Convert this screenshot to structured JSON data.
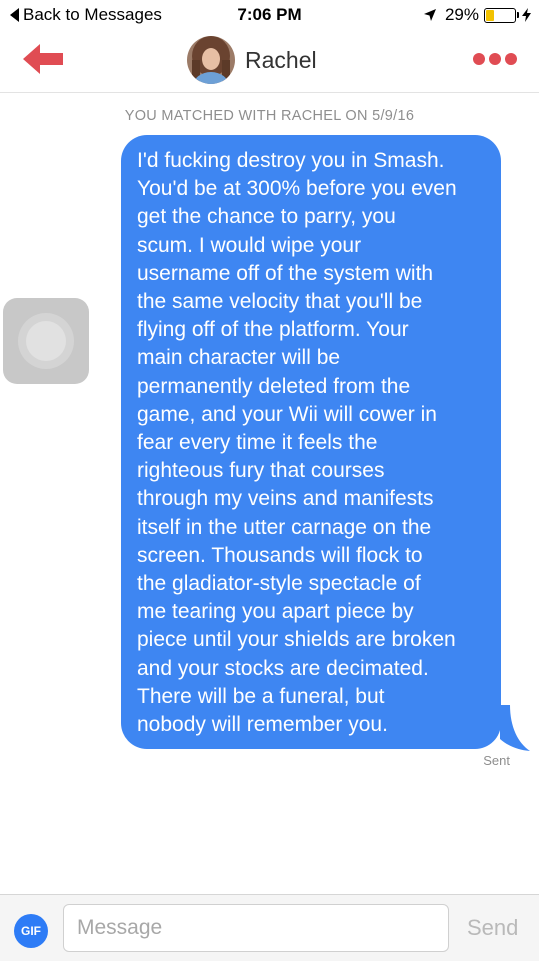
{
  "status_bar": {
    "back_label": "Back to Messages",
    "time": "7:06 PM",
    "battery_text": "29%",
    "battery_level": 0.29,
    "battery_color": "#f2c200"
  },
  "header": {
    "name": "Rachel",
    "back_icon": "back-arrow-icon",
    "menu_icon": "more-dots-icon",
    "accent_color": "#e04c53"
  },
  "match_banner": "YOU MATCHED WITH RACHEL ON 5/9/16",
  "messages": [
    {
      "direction": "outgoing",
      "text": "I'd fucking destroy you in Smash.\nYou'd be at 300% before you even\nget the chance to parry, you\nscum. I would wipe your\nusername off of the system with\nthe same velocity that you'll be\nflying off of the platform. Your\nmain character will be\npermanently deleted from the\ngame, and your Wii will cower in\nfear every time it feels the\nrighteous fury that courses\nthrough my veins and manifests\nitself in the utter carnage on the\nscreen. Thousands will flock to\nthe gladiator-style spectacle of\nme tearing you apart piece by\npiece until your shields are broken\nand your stocks are decimated.\nThere will be a funeral, but\nnobody will remember you.",
      "status": "Sent",
      "bubble_color": "#3e86f2"
    }
  ],
  "input_bar": {
    "gif_label": "GIF",
    "placeholder": "Message",
    "value": "",
    "send_label": "Send"
  }
}
